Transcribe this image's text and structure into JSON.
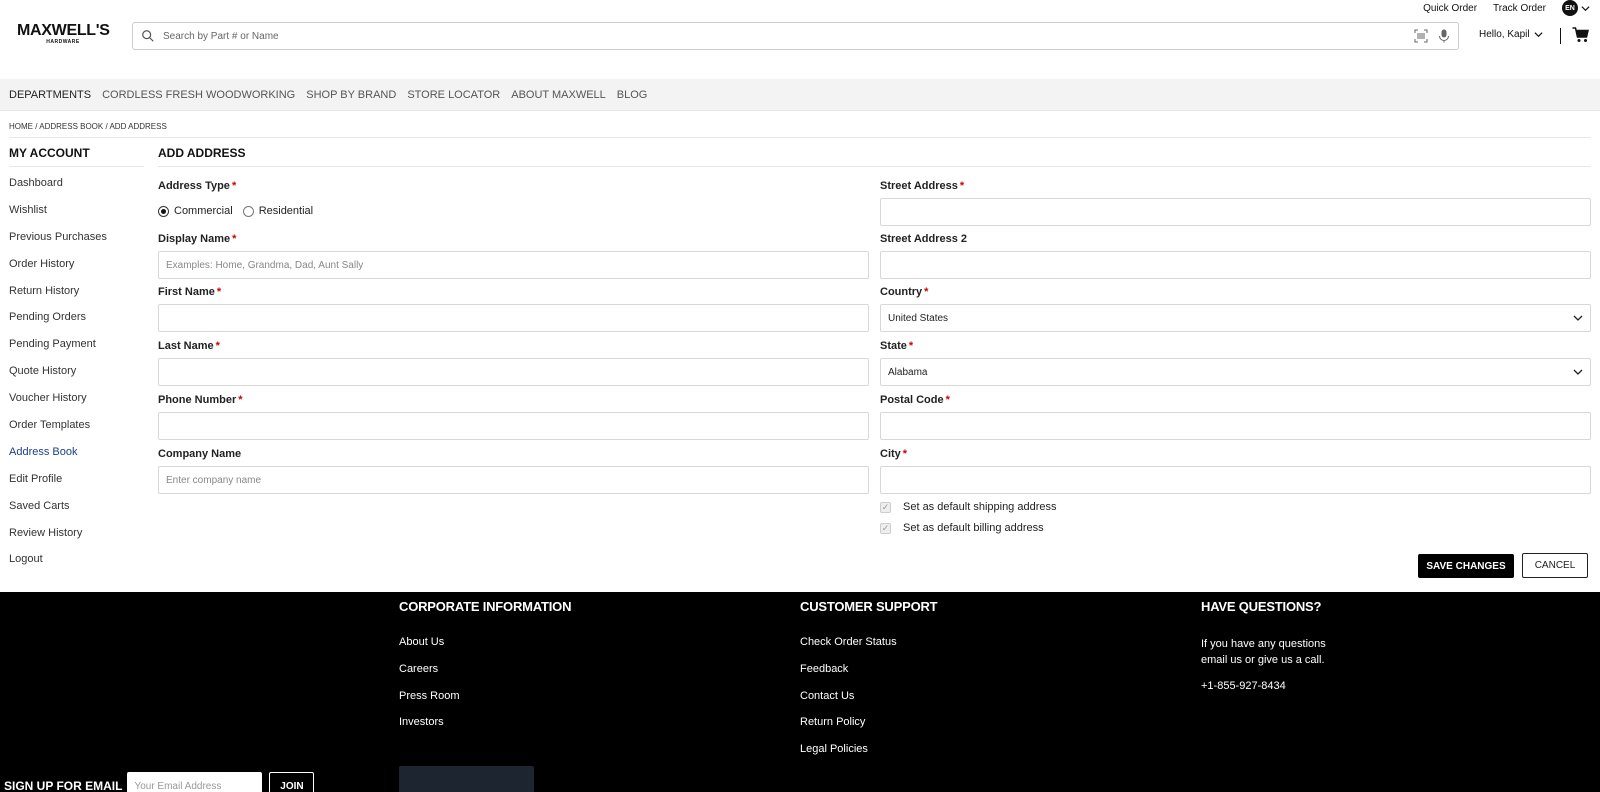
{
  "util": {
    "quick_order": "Quick Order",
    "track_order": "Track Order",
    "lang": "EN"
  },
  "header": {
    "logo_main": "MAXWELL'S",
    "logo_sub": "HARDWARE",
    "search_placeholder": "Search by Part # or Name",
    "greeting": "Hello, Kapil"
  },
  "nav": [
    "DEPARTMENTS",
    "CORDLESS FRESH WOODWORKING",
    "SHOP BY BRAND",
    "STORE LOCATOR",
    "ABOUT MAXWELL",
    "BLOG"
  ],
  "breadcrumb": "HOME / ADDRESS BOOK / ADD ADDRESS",
  "sidebar": {
    "title": "MY ACCOUNT",
    "items": [
      "Dashboard",
      "Wishlist",
      "Previous Purchases",
      "Order History",
      "Return History",
      "Pending Orders",
      "Pending Payment",
      "Quote History",
      "Voucher History",
      "Order Templates",
      "Address Book",
      "Edit Profile",
      "Saved Carts",
      "Review History",
      "Logout"
    ],
    "active": "Address Book"
  },
  "form": {
    "title": "ADD ADDRESS",
    "address_type_label": "Address Type",
    "commercial": "Commercial",
    "residential": "Residential",
    "display_name_label": "Display Name",
    "display_name_placeholder": "Examples: Home, Grandma, Dad, Aunt Sally",
    "first_name_label": "First Name",
    "last_name_label": "Last Name",
    "phone_label": "Phone Number",
    "company_label": "Company Name",
    "company_placeholder": "Enter company name",
    "street_label": "Street Address",
    "street2_label": "Street Address 2",
    "country_label": "Country",
    "country_value": "United States",
    "state_label": "State",
    "state_value": "Alabama",
    "postal_label": "Postal Code",
    "city_label": "City",
    "default_shipping": "Set as default shipping address",
    "default_billing": "Set as default billing address",
    "required_mark": "*",
    "save": "SAVE CHANGES",
    "cancel": "CANCEL"
  },
  "footer": {
    "corporate_title": "CORPORATE INFORMATION",
    "corporate_links": [
      "About Us",
      "Careers",
      "Press Room",
      "Investors"
    ],
    "support_title": "CUSTOMER SUPPORT",
    "support_links": [
      "Check Order Status",
      "Feedback",
      "Contact Us",
      "Return Policy",
      "Legal Policies"
    ],
    "questions_title": "HAVE QUESTIONS?",
    "questions_text": "If you have any questions email us or give us a call.",
    "phone": "+1-855-927-8434",
    "signup_label": "SIGN UP FOR EMAIL",
    "email_placeholder": "Your Email Address",
    "join": "JOIN"
  },
  "colors": {
    "active_link": "#1b3f8b",
    "required": "#cc0000",
    "footer_bg": "#000000"
  }
}
